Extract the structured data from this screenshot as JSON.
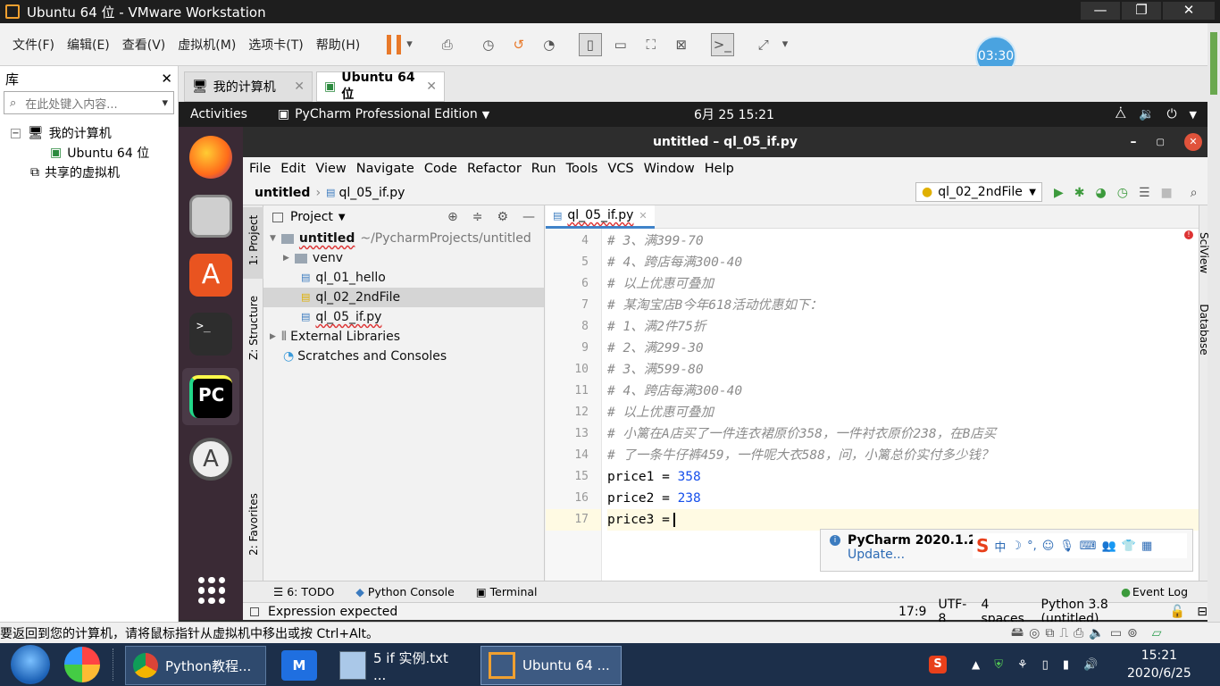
{
  "vm": {
    "title": "Ubuntu 64 位 - VMware Workstation",
    "menu": [
      "文件(F)",
      "编辑(E)",
      "查看(V)",
      "虚拟机(M)",
      "选项卡(T)",
      "帮助(H)"
    ],
    "timer": "03:30",
    "library": {
      "title": "库",
      "search_placeholder": "在此处键入内容...",
      "tree": [
        "我的计算机",
        "Ubuntu 64 位",
        "共享的虚拟机"
      ]
    },
    "tabs": [
      "我的计算机",
      "Ubuntu 64 位"
    ],
    "status_text": "要返回到您的计算机，请将鼠标指针从虚拟机中移出或按 Ctrl+Alt。"
  },
  "gnome": {
    "activities": "Activities",
    "app": "PyCharm Professional Edition",
    "clock": "6月 25  15:21"
  },
  "pycharm": {
    "window_title": "untitled – ql_05_if.py",
    "menu": [
      "File",
      "Edit",
      "View",
      "Navigate",
      "Code",
      "Refactor",
      "Run",
      "Tools",
      "VCS",
      "Window",
      "Help"
    ],
    "breadcrumb_project": "untitled",
    "breadcrumb_file": "ql_05_if.py",
    "run_config": "ql_02_2ndFile",
    "left_tools": [
      "1: Project",
      "Z: Structure",
      "2: Favorites"
    ],
    "right_tools": [
      "SciView",
      "Database"
    ],
    "project_panel": {
      "title": "Project",
      "root": "untitled",
      "root_path": "~/PycharmProjects/untitled",
      "items": [
        "venv",
        "ql_01_hello",
        "ql_02_2ndFile",
        "ql_05_if.py",
        "External Libraries",
        "Scratches and Consoles"
      ]
    },
    "editor_tab": "ql_05_if.py",
    "code": [
      {
        "n": "4",
        "text": "# 3、满399-70",
        "kind": "cmt"
      },
      {
        "n": "5",
        "text": "# 4、跨店每满300-40",
        "kind": "cmt"
      },
      {
        "n": "6",
        "text": "# 以上优惠可叠加",
        "kind": "cmt"
      },
      {
        "n": "7",
        "text": "# 某淘宝店B今年618活动优惠如下：",
        "kind": "cmt"
      },
      {
        "n": "8",
        "text": "# 1、满2件75折",
        "kind": "cmt"
      },
      {
        "n": "9",
        "text": "# 2、满299-30",
        "kind": "cmt"
      },
      {
        "n": "10",
        "text": "# 3、满599-80",
        "kind": "cmt"
      },
      {
        "n": "11",
        "text": "# 4、跨店每满300-40",
        "kind": "cmt"
      },
      {
        "n": "12",
        "text": "# 以上优惠可叠加",
        "kind": "cmt"
      },
      {
        "n": "13",
        "text": "# 小篱在A店买了一件连衣裙原价358，一件衬衣原价238，在B店买",
        "kind": "cmt"
      },
      {
        "n": "14",
        "text": "# 了一条牛仔裤459，一件呢大衣588，问，小篱总价实付多少钱？",
        "kind": "cmt"
      },
      {
        "n": "15",
        "text": "price1 = ",
        "num": "358",
        "kind": "code"
      },
      {
        "n": "16",
        "text": "price2 = ",
        "num": "238",
        "kind": "code"
      },
      {
        "n": "17",
        "text": "price3 =",
        "kind": "code"
      }
    ],
    "notification": {
      "title": "PyCharm 2020.1.2 a",
      "link": "Update..."
    },
    "bottom_tabs": [
      "6: TODO",
      "Python Console",
      "Terminal"
    ],
    "event_log": "Event Log",
    "status_message": "Expression expected",
    "status_right": [
      "17:9",
      "UTF-8",
      "4 spaces",
      "Python 3.8 (untitled)"
    ]
  },
  "taskbar": {
    "items": [
      "Python教程...",
      "5 if 实例.txt ...",
      "Ubuntu 64 ..."
    ],
    "time": "15:21",
    "date": "2020/6/25"
  }
}
